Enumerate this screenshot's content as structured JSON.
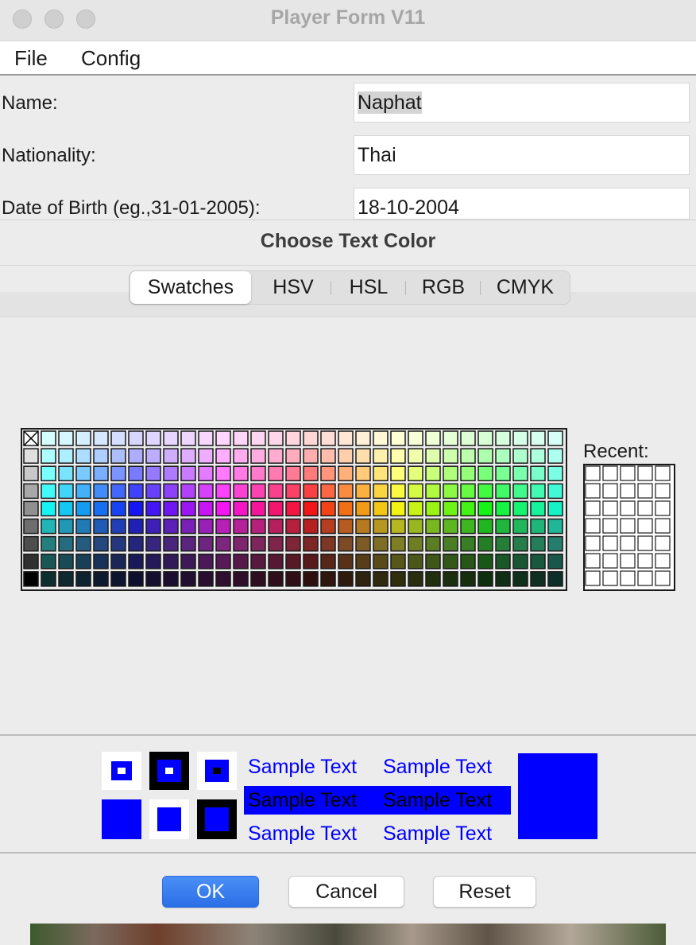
{
  "window": {
    "title": "Player Form V11"
  },
  "menu": {
    "items": [
      "File",
      "Config"
    ]
  },
  "form": {
    "name_label": "Name:",
    "name_value": "Naphat",
    "nationality_label": "Nationality:",
    "nationality_value": "Thai",
    "dob_label": "Date of Birth (eg.,31-01-2005):",
    "dob_value": "18-10-2004"
  },
  "dialog": {
    "title": "Choose Text Color",
    "tabs": [
      "Swatches",
      "HSV",
      "HSL",
      "RGB",
      "CMYK"
    ],
    "active_tab": "Swatches",
    "recent_label": "Recent:",
    "preview": {
      "sample_text": "Sample Text",
      "color": "#0000ff"
    },
    "buttons": {
      "ok": "OK",
      "cancel": "Cancel",
      "reset": "Reset"
    }
  },
  "colors": {
    "accent": "#2b6fe6",
    "selected": "#0000ff"
  }
}
